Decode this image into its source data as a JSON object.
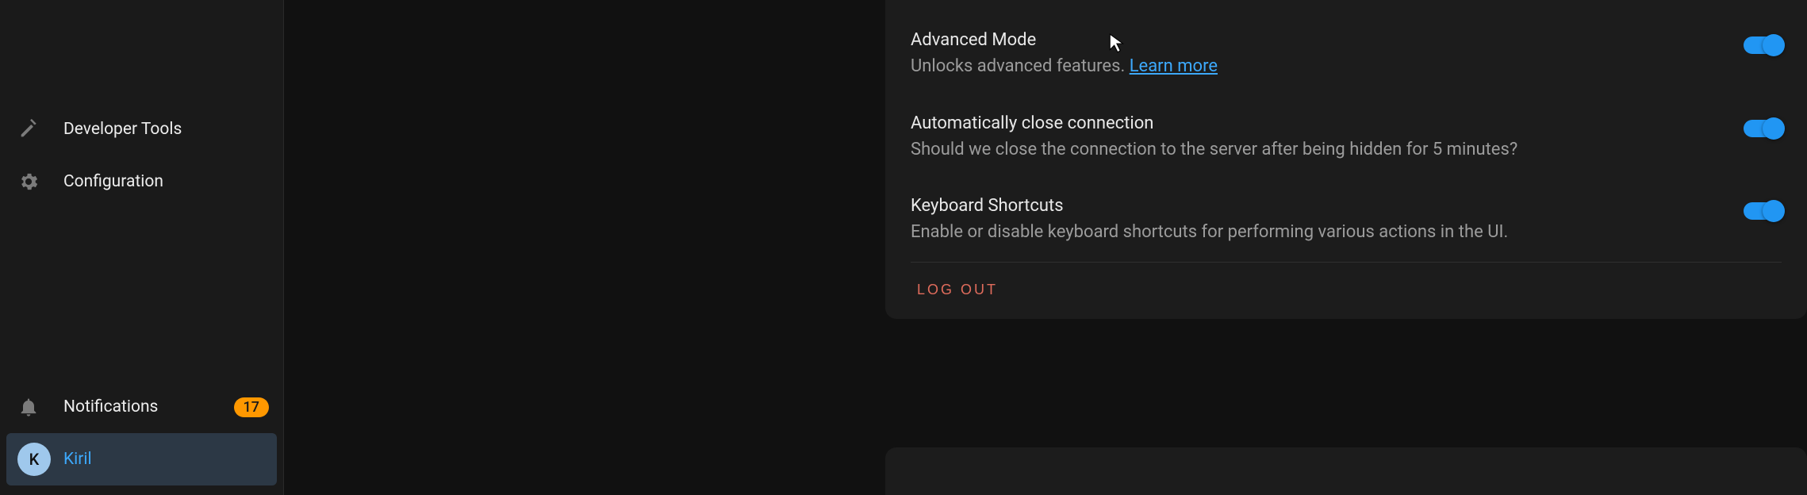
{
  "sidebar": {
    "items": [
      {
        "label": "Developer Tools"
      },
      {
        "label": "Configuration"
      },
      {
        "label": "Notifications",
        "badge": "17"
      },
      {
        "label": "Kiril",
        "avatar_initial": "K"
      }
    ]
  },
  "settings": {
    "advanced_mode": {
      "title": "Advanced Mode",
      "desc_prefix": "Unlocks advanced features. ",
      "learn_more": "Learn more",
      "enabled": true
    },
    "auto_close": {
      "title": "Automatically close connection",
      "desc": "Should we close the connection to the server after being hidden for 5 minutes?",
      "enabled": true
    },
    "keyboard_shortcuts": {
      "title": "Keyboard Shortcuts",
      "desc": "Enable or disable keyboard shortcuts for performing various actions in the UI.",
      "enabled": true
    },
    "logout_label": "LOG OUT"
  }
}
